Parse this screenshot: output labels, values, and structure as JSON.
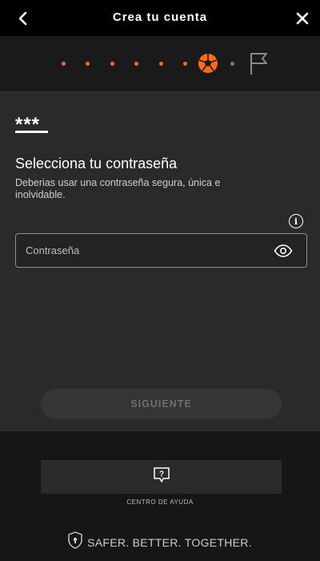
{
  "header": {
    "title": "Crea tu cuenta",
    "back_icon": "chevron-left-icon",
    "close_icon": "close-icon"
  },
  "progress": {
    "completed_steps": 6,
    "current_step_icon": "soccer-ball-icon",
    "remaining_steps": 1,
    "final_step_icon": "flag-icon",
    "accent_color": "#ff6a13"
  },
  "logo_text": "***",
  "form": {
    "heading": "Selecciona tu contraseña",
    "description": "Deberias usar una contraseña segura, única e inolvidable.",
    "info_symbol": "i",
    "password_placeholder": "Contraseña",
    "password_value": "",
    "toggle_icon": "eye-icon"
  },
  "buttons": {
    "next_label": "SIGUIENTE"
  },
  "footer": {
    "help_label": "CENTRO DE AYUDA",
    "help_icon": "help-chat-icon",
    "slogan": "SAFER. BETTER. TOGETHER.",
    "slogan_icon": "shield-lock-icon"
  }
}
